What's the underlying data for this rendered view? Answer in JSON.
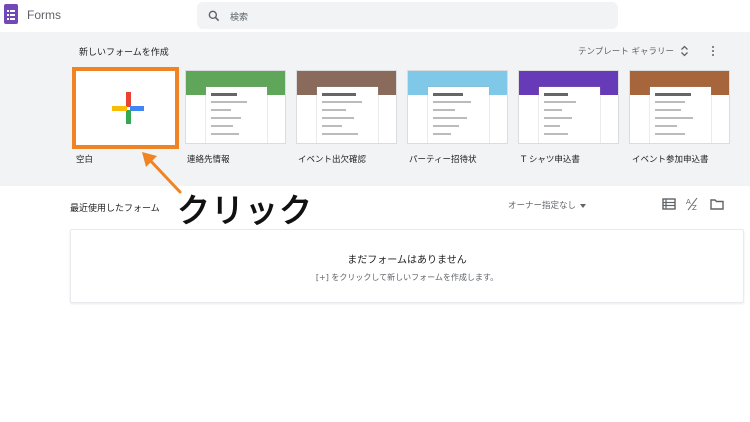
{
  "app": {
    "title": "Forms"
  },
  "search": {
    "placeholder": "検索"
  },
  "templates": {
    "section_title": "新しいフォームを作成",
    "gallery_label": "テンプレート ギャラリー",
    "items": [
      {
        "label": "空白"
      },
      {
        "label": "連絡先情報",
        "accent": "#5fa55a"
      },
      {
        "label": "イベント出欠確認",
        "accent": "#8a6a5a"
      },
      {
        "label": "パーティー招待状",
        "accent": "#7fc8e8"
      },
      {
        "label": "T シャツ申込書",
        "accent": "#673ab7"
      },
      {
        "label": "イベント参加申込書",
        "accent": "#a7653c"
      }
    ]
  },
  "annotation": {
    "callout": "クリック",
    "color": "#f08424"
  },
  "recent": {
    "title": "最近使用したフォーム",
    "owner_filter": "オーナー指定なし",
    "empty_title": "まだフォームはありません",
    "empty_hint": "[+] をクリックして新しいフォームを作成します。"
  },
  "colors": {
    "brand": "#7248b9",
    "band": "#f1f3f4"
  },
  "icons": [
    "forms-logo-icon",
    "search-icon",
    "unfold-icon",
    "more-vert-icon",
    "plus-icon",
    "list-view-icon",
    "sort-az-icon",
    "folder-icon"
  ]
}
